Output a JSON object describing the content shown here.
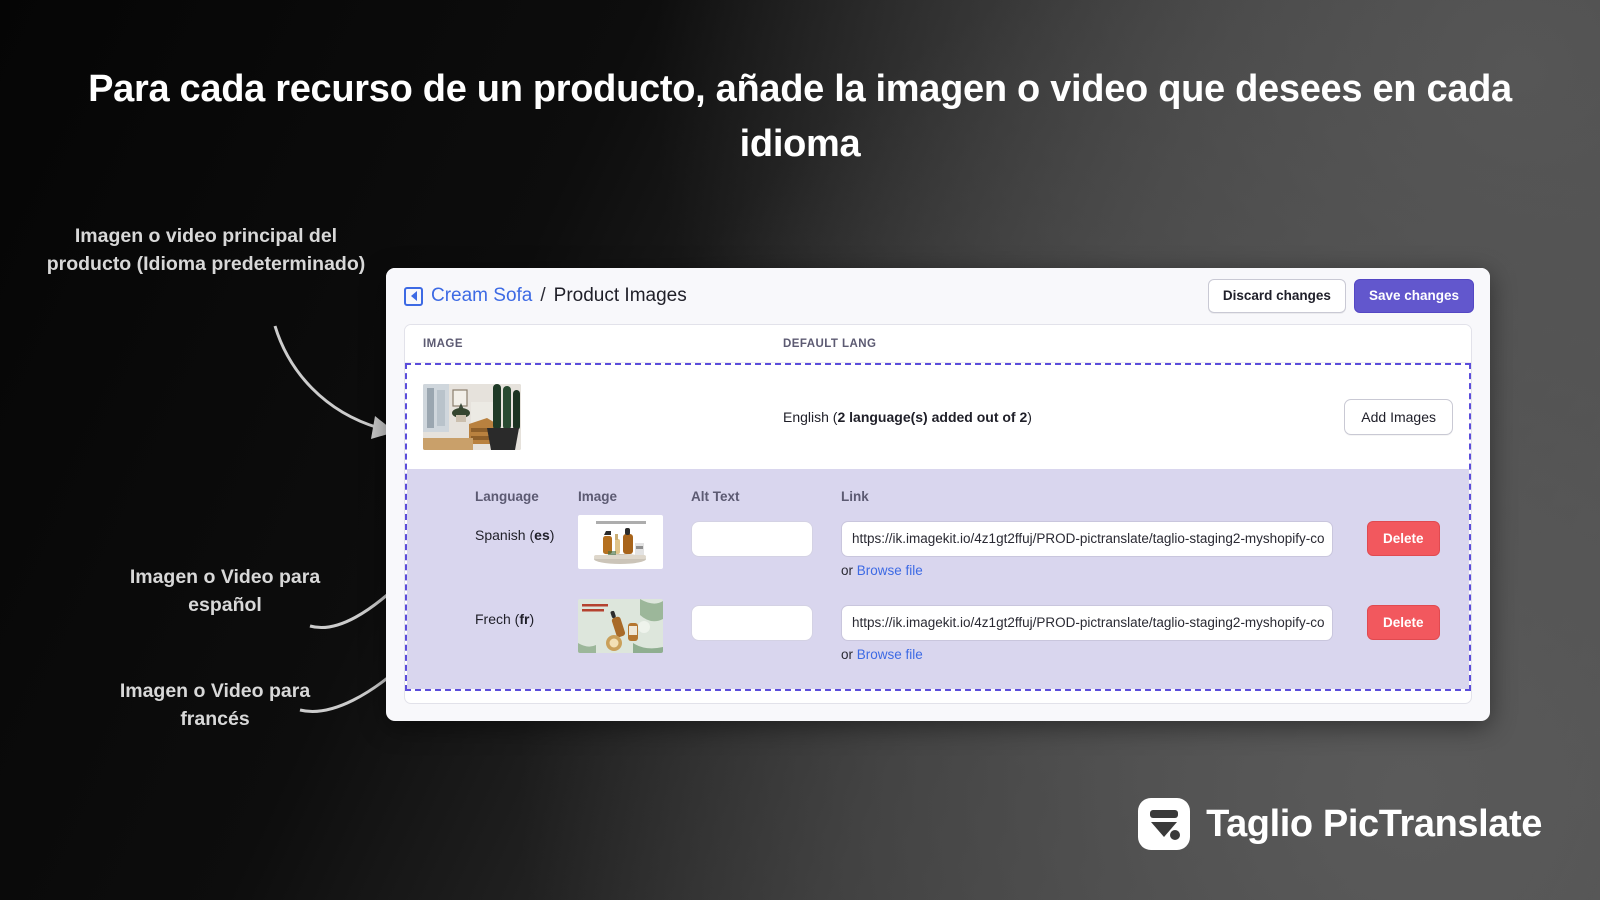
{
  "headline": "Para cada recurso de un producto, añade la imagen o video que desees en cada idioma",
  "callouts": {
    "main_image": "Imagen o video principal del producto (Idioma predeterminado)",
    "spanish": "Imagen o Video para español",
    "french": "Imagen o Video para francés"
  },
  "app": {
    "breadcrumb": {
      "back_icon": "back-arrow-icon",
      "parent": "Cream Sofa",
      "separator": "/",
      "current": "Product Images"
    },
    "actions": {
      "discard": "Discard changes",
      "save": "Save changes"
    },
    "table": {
      "headers": {
        "image": "IMAGE",
        "default_lang": "DEFAULT LANG"
      },
      "default_row": {
        "lang_prefix": "English (",
        "lang_count": "2 language(s) added out of 2",
        "lang_suffix": ")",
        "add_images": "Add Images",
        "thumbnail": "living-room-cactus-thumbnail"
      }
    },
    "lang_panel": {
      "headers": {
        "language": "Language",
        "image": "Image",
        "alt_text": "Alt Text",
        "link": "Link"
      },
      "or_label": "or",
      "browse_label": "Browse file",
      "delete_label": "Delete",
      "alt_placeholder": "",
      "rows": [
        {
          "language_name": "Spanish",
          "language_code": "es",
          "thumbnail": "amber-bottles-tray-thumbnail",
          "alt_text": "",
          "link": "https://ik.imagekit.io/4z1gt2ffuj/PROD-pictranslate/taglio-staging2-myshopify-co"
        },
        {
          "language_name": "Frech",
          "language_code": "fr",
          "thumbnail": "green-flatlay-bottles-thumbnail",
          "alt_text": "",
          "link": "https://ik.imagekit.io/4z1gt2ffuj/PROD-pictranslate/taglio-staging2-myshopify-co"
        }
      ]
    }
  },
  "brand": {
    "logo_icon": "taglio-funnel-logo",
    "name": "Taglio PicTranslate"
  },
  "colors": {
    "accent_purple": "#6257cd",
    "dashed_border": "#5b4ddb",
    "panel_lavender": "#d9d6ee",
    "link_blue": "#3d6ae4",
    "danger_red": "#f2585e"
  }
}
